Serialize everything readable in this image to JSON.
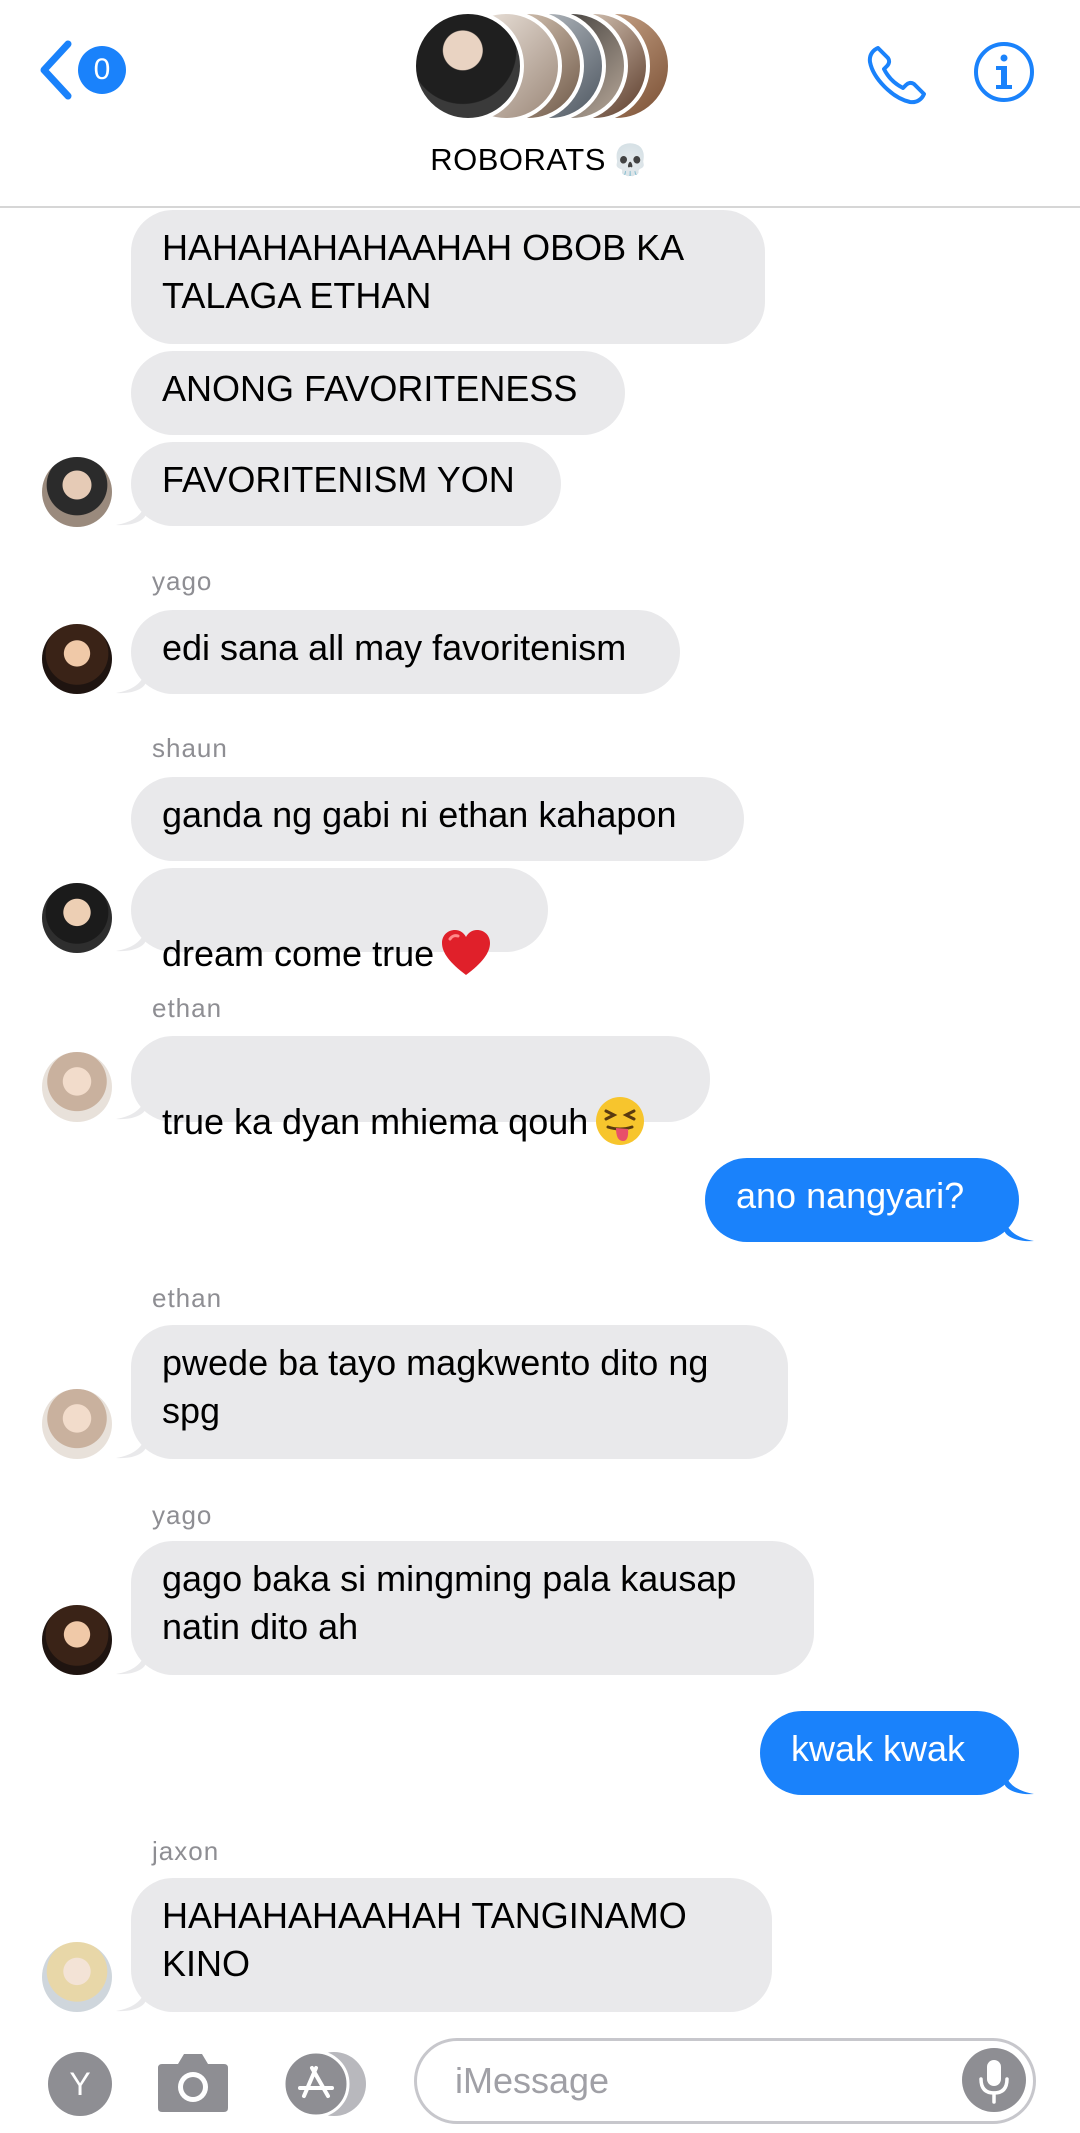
{
  "header": {
    "back_count": "0",
    "title": "ROBORATS",
    "title_emoji": "💀"
  },
  "messages": [
    {
      "id": "m1",
      "direction": "incoming",
      "text": "HAHAHAHAHAAHAH OBOB KA\nTALAGA ETHAN"
    },
    {
      "id": "m2",
      "direction": "incoming",
      "text": "ANONG FAVORITENESS"
    },
    {
      "id": "m3",
      "direction": "incoming",
      "text": "FAVORITENISM YON"
    },
    {
      "id": "m4",
      "direction": "incoming",
      "sender": "yago",
      "text": "edi sana all may favoritenism"
    },
    {
      "id": "m5",
      "direction": "incoming",
      "sender": "shaun",
      "text": "ganda ng gabi ni ethan kahapon"
    },
    {
      "id": "m6",
      "direction": "incoming",
      "text": "dream come true",
      "emoji": "red-heart"
    },
    {
      "id": "m7",
      "direction": "incoming",
      "sender": "ethan",
      "text": "true ka dyan mhiema qouh",
      "emoji": "squinting-face-with-tongue"
    },
    {
      "id": "m8",
      "direction": "outgoing",
      "text": "ano nangyari?"
    },
    {
      "id": "m9",
      "direction": "incoming",
      "sender": "ethan",
      "text": "pwede ba tayo magkwento dito ng\nspg"
    },
    {
      "id": "m10",
      "direction": "incoming",
      "sender": "yago",
      "text": "gago baka si mingming pala kausap\nnatin dito ah"
    },
    {
      "id": "m11",
      "direction": "outgoing",
      "text": "kwak kwak"
    },
    {
      "id": "m12",
      "direction": "incoming",
      "sender": "jaxon",
      "text": "HAHAHAHAAHAH TANGINAMO\nKINO"
    }
  ],
  "senders": {
    "s1": "yago",
    "s2": "shaun",
    "s3": "ethan",
    "s4": "ethan",
    "s5": "yago",
    "s6": "jaxon"
  },
  "input": {
    "app_button_label": "Y",
    "placeholder": "iMessage"
  },
  "icons": {
    "back": "chevron-left-icon",
    "phone": "phone-icon",
    "info": "info-icon",
    "camera": "camera-icon",
    "appstore": "app-store-icon",
    "mic": "microphone-icon"
  },
  "colors": {
    "accent": "#1a82fb",
    "incoming_bubble": "#e9e9eb",
    "sender_label": "#8e8e93"
  }
}
